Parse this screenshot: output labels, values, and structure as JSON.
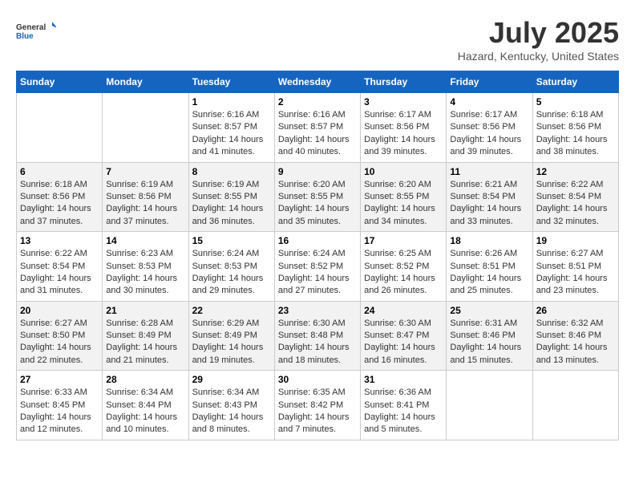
{
  "logo": {
    "general": "General",
    "blue": "Blue"
  },
  "header": {
    "month": "July 2025",
    "location": "Hazard, Kentucky, United States"
  },
  "weekdays": [
    "Sunday",
    "Monday",
    "Tuesday",
    "Wednesday",
    "Thursday",
    "Friday",
    "Saturday"
  ],
  "weeks": [
    [
      {
        "day": "",
        "info": ""
      },
      {
        "day": "",
        "info": ""
      },
      {
        "day": "1",
        "info": "Sunrise: 6:16 AM\nSunset: 8:57 PM\nDaylight: 14 hours\nand 41 minutes."
      },
      {
        "day": "2",
        "info": "Sunrise: 6:16 AM\nSunset: 8:57 PM\nDaylight: 14 hours\nand 40 minutes."
      },
      {
        "day": "3",
        "info": "Sunrise: 6:17 AM\nSunset: 8:56 PM\nDaylight: 14 hours\nand 39 minutes."
      },
      {
        "day": "4",
        "info": "Sunrise: 6:17 AM\nSunset: 8:56 PM\nDaylight: 14 hours\nand 39 minutes."
      },
      {
        "day": "5",
        "info": "Sunrise: 6:18 AM\nSunset: 8:56 PM\nDaylight: 14 hours\nand 38 minutes."
      }
    ],
    [
      {
        "day": "6",
        "info": "Sunrise: 6:18 AM\nSunset: 8:56 PM\nDaylight: 14 hours\nand 37 minutes."
      },
      {
        "day": "7",
        "info": "Sunrise: 6:19 AM\nSunset: 8:56 PM\nDaylight: 14 hours\nand 37 minutes."
      },
      {
        "day": "8",
        "info": "Sunrise: 6:19 AM\nSunset: 8:55 PM\nDaylight: 14 hours\nand 36 minutes."
      },
      {
        "day": "9",
        "info": "Sunrise: 6:20 AM\nSunset: 8:55 PM\nDaylight: 14 hours\nand 35 minutes."
      },
      {
        "day": "10",
        "info": "Sunrise: 6:20 AM\nSunset: 8:55 PM\nDaylight: 14 hours\nand 34 minutes."
      },
      {
        "day": "11",
        "info": "Sunrise: 6:21 AM\nSunset: 8:54 PM\nDaylight: 14 hours\nand 33 minutes."
      },
      {
        "day": "12",
        "info": "Sunrise: 6:22 AM\nSunset: 8:54 PM\nDaylight: 14 hours\nand 32 minutes."
      }
    ],
    [
      {
        "day": "13",
        "info": "Sunrise: 6:22 AM\nSunset: 8:54 PM\nDaylight: 14 hours\nand 31 minutes."
      },
      {
        "day": "14",
        "info": "Sunrise: 6:23 AM\nSunset: 8:53 PM\nDaylight: 14 hours\nand 30 minutes."
      },
      {
        "day": "15",
        "info": "Sunrise: 6:24 AM\nSunset: 8:53 PM\nDaylight: 14 hours\nand 29 minutes."
      },
      {
        "day": "16",
        "info": "Sunrise: 6:24 AM\nSunset: 8:52 PM\nDaylight: 14 hours\nand 27 minutes."
      },
      {
        "day": "17",
        "info": "Sunrise: 6:25 AM\nSunset: 8:52 PM\nDaylight: 14 hours\nand 26 minutes."
      },
      {
        "day": "18",
        "info": "Sunrise: 6:26 AM\nSunset: 8:51 PM\nDaylight: 14 hours\nand 25 minutes."
      },
      {
        "day": "19",
        "info": "Sunrise: 6:27 AM\nSunset: 8:51 PM\nDaylight: 14 hours\nand 23 minutes."
      }
    ],
    [
      {
        "day": "20",
        "info": "Sunrise: 6:27 AM\nSunset: 8:50 PM\nDaylight: 14 hours\nand 22 minutes."
      },
      {
        "day": "21",
        "info": "Sunrise: 6:28 AM\nSunset: 8:49 PM\nDaylight: 14 hours\nand 21 minutes."
      },
      {
        "day": "22",
        "info": "Sunrise: 6:29 AM\nSunset: 8:49 PM\nDaylight: 14 hours\nand 19 minutes."
      },
      {
        "day": "23",
        "info": "Sunrise: 6:30 AM\nSunset: 8:48 PM\nDaylight: 14 hours\nand 18 minutes."
      },
      {
        "day": "24",
        "info": "Sunrise: 6:30 AM\nSunset: 8:47 PM\nDaylight: 14 hours\nand 16 minutes."
      },
      {
        "day": "25",
        "info": "Sunrise: 6:31 AM\nSunset: 8:46 PM\nDaylight: 14 hours\nand 15 minutes."
      },
      {
        "day": "26",
        "info": "Sunrise: 6:32 AM\nSunset: 8:46 PM\nDaylight: 14 hours\nand 13 minutes."
      }
    ],
    [
      {
        "day": "27",
        "info": "Sunrise: 6:33 AM\nSunset: 8:45 PM\nDaylight: 14 hours\nand 12 minutes."
      },
      {
        "day": "28",
        "info": "Sunrise: 6:34 AM\nSunset: 8:44 PM\nDaylight: 14 hours\nand 10 minutes."
      },
      {
        "day": "29",
        "info": "Sunrise: 6:34 AM\nSunset: 8:43 PM\nDaylight: 14 hours\nand 8 minutes."
      },
      {
        "day": "30",
        "info": "Sunrise: 6:35 AM\nSunset: 8:42 PM\nDaylight: 14 hours\nand 7 minutes."
      },
      {
        "day": "31",
        "info": "Sunrise: 6:36 AM\nSunset: 8:41 PM\nDaylight: 14 hours\nand 5 minutes."
      },
      {
        "day": "",
        "info": ""
      },
      {
        "day": "",
        "info": ""
      }
    ]
  ]
}
